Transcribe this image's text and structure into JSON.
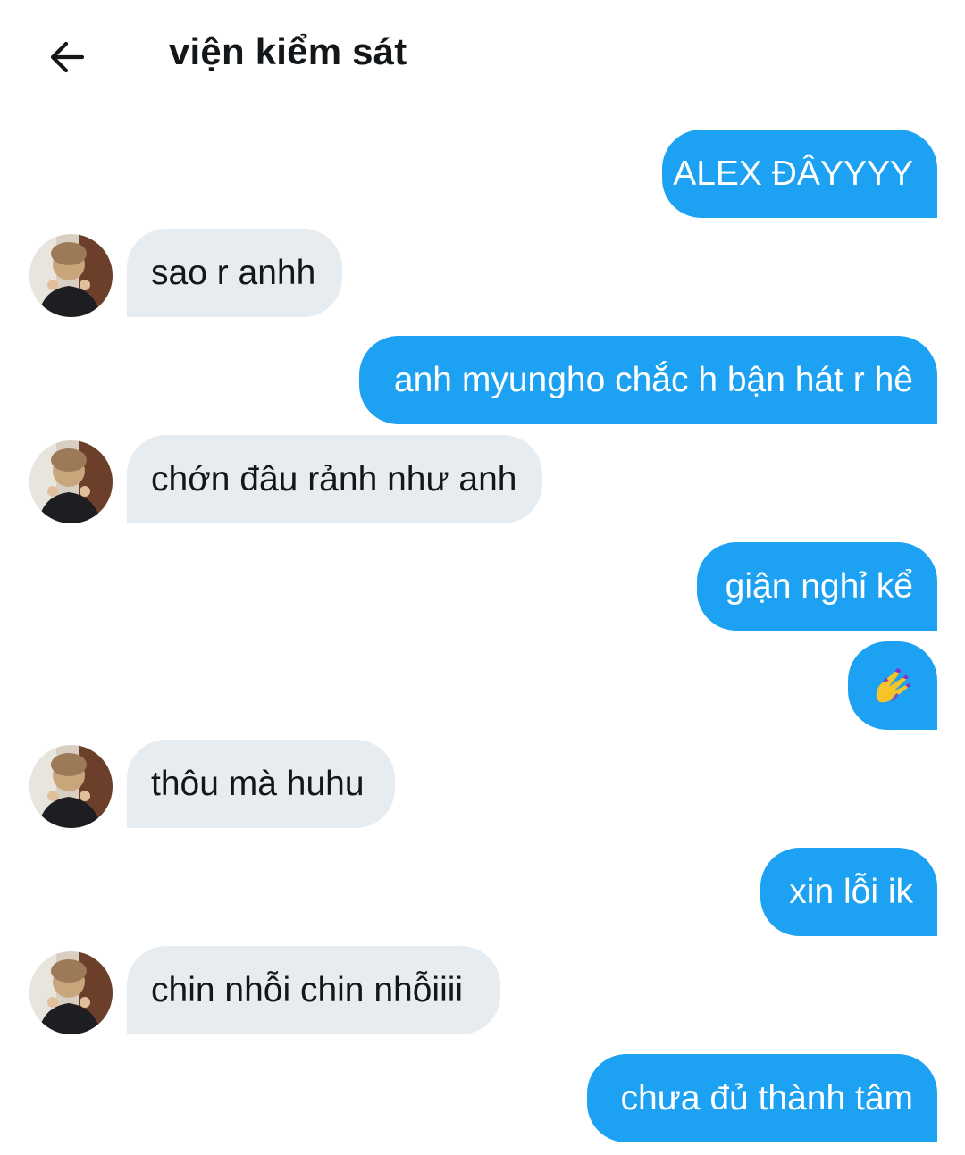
{
  "header": {
    "back_icon": "arrow-left-icon",
    "title": "viện kiểm sát"
  },
  "colors": {
    "outgoing_bubble": "#1da1f2",
    "incoming_bubble": "#e6ecf0",
    "text_dark": "#14171a"
  },
  "messages": [
    {
      "direction": "out",
      "text": "ALEX ĐÂYYYY"
    },
    {
      "direction": "in",
      "text": "sao r anhh"
    },
    {
      "direction": "out",
      "text": "anh myungho chắc h bận hát r hê"
    },
    {
      "direction": "in",
      "text": "chớn đâu rảnh như anh"
    },
    {
      "direction": "out",
      "text": "giận nghỉ kể"
    },
    {
      "direction": "out",
      "text": "",
      "icon": "nail-polish-icon"
    },
    {
      "direction": "in",
      "text": "thôu mà huhu"
    },
    {
      "direction": "out",
      "text": "xin lỗi ik"
    },
    {
      "direction": "in",
      "text": "chin nhỗi chin nhỗiiii"
    },
    {
      "direction": "out",
      "text": "chưa đủ thành tâm"
    }
  ]
}
